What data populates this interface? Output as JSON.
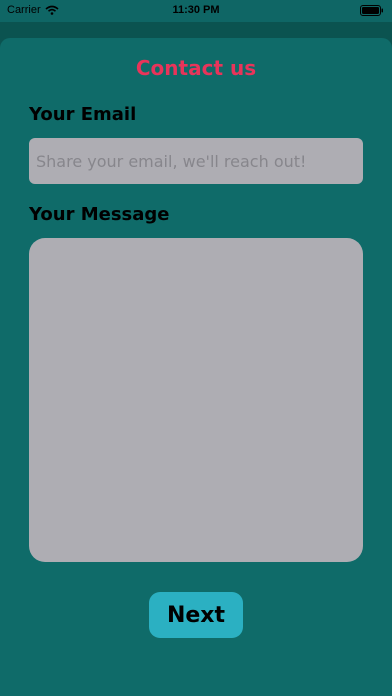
{
  "status_bar": {
    "carrier": "Carrier",
    "time": "11:30 PM",
    "icons": [
      "wifi-icon",
      "battery-icon"
    ]
  },
  "form": {
    "title": "Contact us",
    "email_label": "Your Email",
    "email_placeholder": "Share your email, we'll reach out!",
    "email_value": "",
    "message_label": "Your Message",
    "message_value": "",
    "next_label": "Next"
  },
  "colors": {
    "background": "#0f6b69",
    "title": "#e8345a",
    "input_fill": "#aeadb3",
    "button": "#2bb0c2"
  }
}
